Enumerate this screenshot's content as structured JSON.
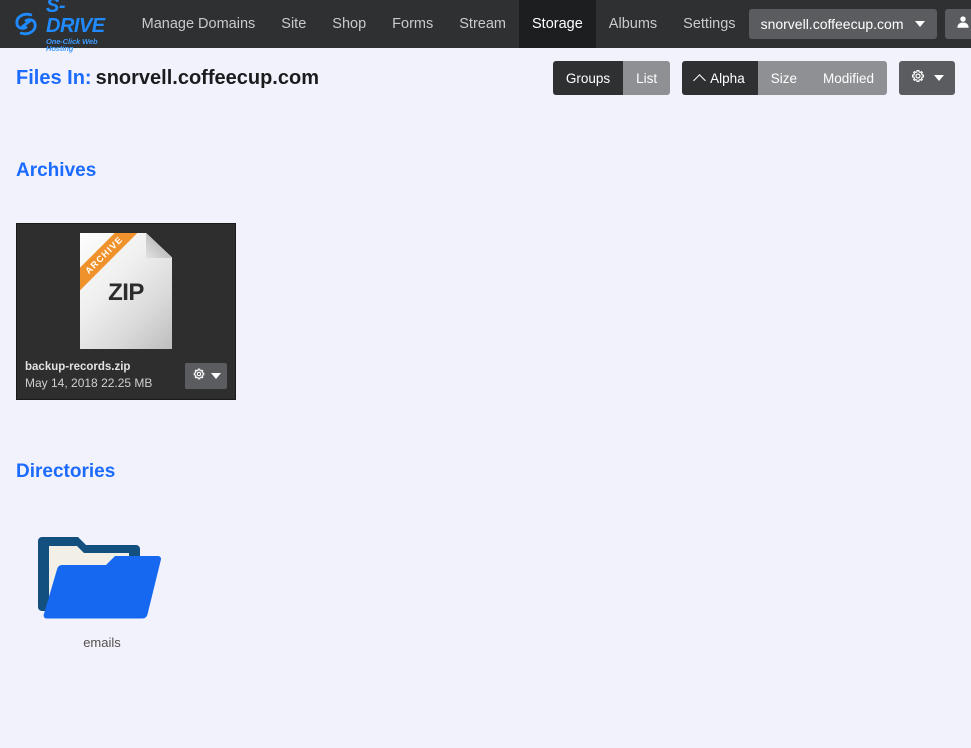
{
  "navbar": {
    "brand": {
      "title": "S-DRIVE",
      "tagline": "One-Click Web Hosting",
      "icon": "s-drive-logo-icon"
    },
    "items": [
      {
        "label": "Manage Domains",
        "active": false
      },
      {
        "label": "Site",
        "active": false
      },
      {
        "label": "Shop",
        "active": false
      },
      {
        "label": "Forms",
        "active": false
      },
      {
        "label": "Stream",
        "active": false
      },
      {
        "label": "Storage",
        "active": true
      },
      {
        "label": "Albums",
        "active": false
      },
      {
        "label": "Settings",
        "active": false
      }
    ],
    "domain_select": {
      "value": "snorvell.coffeecup.com",
      "icon": "chevron-down-icon"
    },
    "user_menu": {
      "icon": "user-icon",
      "caret_icon": "chevron-down-icon"
    }
  },
  "page_header": {
    "label": "Files In:",
    "location": "snorvell.coffeecup.com"
  },
  "toolbar": {
    "view_group": [
      {
        "label": "Groups",
        "active": true
      },
      {
        "label": "List",
        "active": false
      }
    ],
    "sort_group": [
      {
        "label": "Alpha",
        "active": true,
        "icon": "chevron-up-icon"
      },
      {
        "label": "Size",
        "active": false
      },
      {
        "label": "Modified",
        "active": false
      }
    ],
    "settings_button": {
      "icon": "gear-icon",
      "caret_icon": "chevron-down-icon"
    }
  },
  "sections": {
    "archives": {
      "title": "Archives",
      "files": [
        {
          "name": "backup-records.zip",
          "date": "May 14, 2018",
          "size": "22.25 MB",
          "type_label": "ZIP",
          "ribbon": "ARCHIVE",
          "icon": "zip-file-icon",
          "menu_icon": "gear-icon",
          "menu_caret_icon": "chevron-down-icon"
        }
      ]
    },
    "directories": {
      "title": "Directories",
      "folders": [
        {
          "name": "emails",
          "icon": "folder-icon"
        }
      ]
    }
  },
  "colors": {
    "navbar_bg": "#2e3032",
    "navbar_active_bg": "#1d1e20",
    "page_bg": "#f2f2fd",
    "accent_blue": "#1b6bff",
    "brand_blue": "#1f8bff",
    "card_bg": "#2e2e2e",
    "button_grey": "#8e9094",
    "button_dark": "#2e3032",
    "gear_grey": "#5a5c5f",
    "ribbon_orange": "#f0922b",
    "folder_blue": "#1668f0",
    "folder_dark": "#14507f"
  }
}
